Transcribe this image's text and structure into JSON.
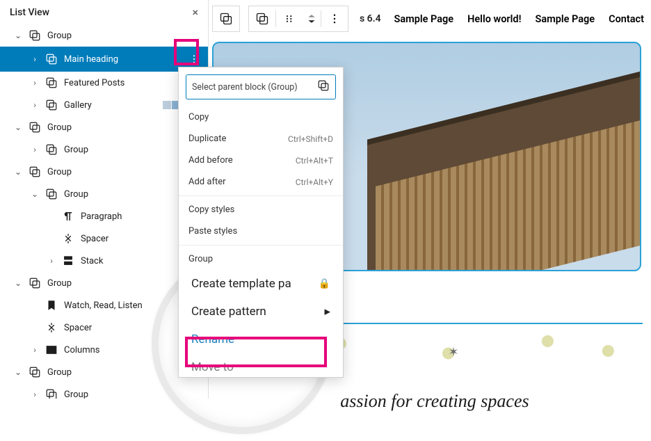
{
  "panel": {
    "title": "List View"
  },
  "tree": {
    "group": "Group",
    "main_heading": "Main heading",
    "featured_posts": "Featured Posts",
    "gallery": "Gallery",
    "paragraph": "Paragraph",
    "spacer": "Spacer",
    "stack": "Stack",
    "watch": "Watch, Read, Listen",
    "columns": "Columns"
  },
  "version": "s 6.4",
  "nav": {
    "l0": "Sample Page",
    "l1": "Hello world!",
    "l2": "Sample Page",
    "l3": "Contact"
  },
  "menu": {
    "parent": "Select parent block (Group)",
    "copy": "Copy",
    "duplicate": "Duplicate",
    "dup_sc": "Ctrl+Shift+D",
    "add_before": "Add before",
    "add_before_sc": "Ctrl+Alt+T",
    "add_after": "Add after",
    "add_after_sc": "Ctrl+Alt+Y",
    "copy_styles": "Copy styles",
    "paste_styles": "Paste styles",
    "group": "Group",
    "create_tpl": "Create template pa",
    "create_pat": "Create pattern",
    "rename": "Rename",
    "move_to": "Move to"
  },
  "tagline": "assion for creating spaces"
}
